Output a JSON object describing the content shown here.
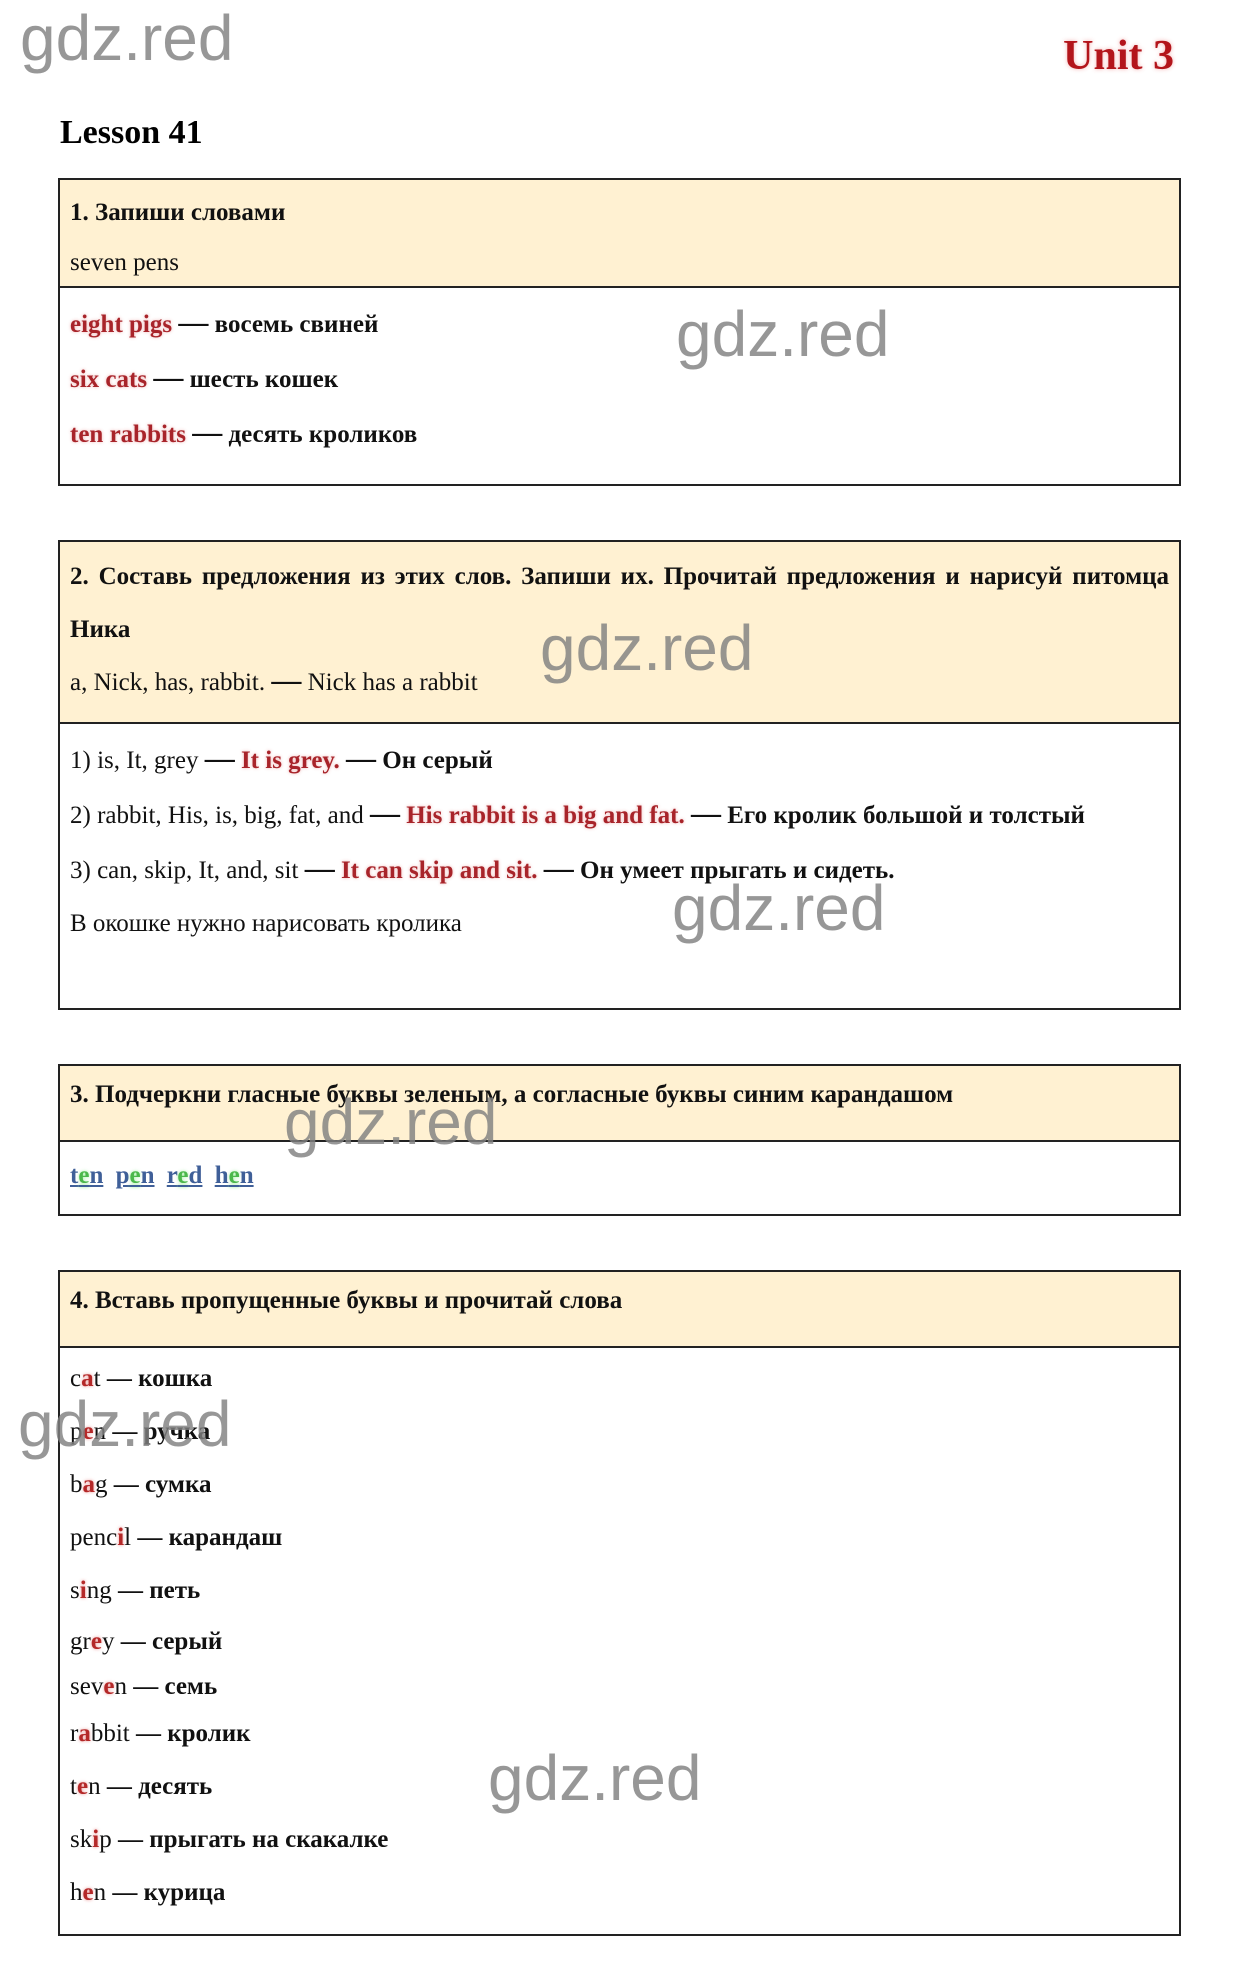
{
  "watermark": "gdz.red",
  "header": {
    "unit": "Unit 3",
    "lesson": "Lesson 41"
  },
  "task1": {
    "title": "1. Запиши словами",
    "example": "seven pens",
    "answers": [
      {
        "en": "eight pigs",
        "dash": "—",
        "ru": "восемь свиней"
      },
      {
        "en": "six cats",
        "dash": "—",
        "ru": "шесть кошек"
      },
      {
        "en": "ten rabbits",
        "dash": "—",
        "ru": "десять кроликов"
      }
    ]
  },
  "task2": {
    "title": "2. Составь предложения из этих слов. Запиши их. Прочитай предложения и нарисуй питомца Ника",
    "example_words": "a, Nick, has, rabbit.",
    "example_dash": "—",
    "example_sentence": "Nick has a rabbit",
    "answers": [
      {
        "words": "1) is, It, grey",
        "sentence": "It is grey.",
        "translation": "Он серый"
      },
      {
        "words": "2) rabbit, His, is, big, fat, and",
        "sentence": "His rabbit is a big and fat.",
        "translation": "Его кролик большой и толстый"
      },
      {
        "words": "3) can, skip, It, and, sit",
        "sentence": "It can skip and sit.",
        "translation": "Он умеет прыгать и сидеть."
      }
    ],
    "dash": "—",
    "note": "В окошке нужно нарисовать кролика"
  },
  "task3": {
    "title": "3. Подчеркни гласные буквы зеленым, а согласные буквы синим карандашом",
    "words": [
      {
        "pre": "t",
        "vowel": "e",
        "post": "n"
      },
      {
        "pre": "p",
        "vowel": "e",
        "post": "n"
      },
      {
        "pre": "r",
        "vowel": "e",
        "post": "d"
      },
      {
        "pre": "h",
        "vowel": "e",
        "post": "n"
      }
    ],
    "colors": {
      "vowel": "#4cb84c",
      "consonant": "#3f5f98"
    }
  },
  "task4": {
    "title": "4. Вставь пропущенные буквы и прочитай слова",
    "dash": "—",
    "items": [
      {
        "pre": "c",
        "missing": "a",
        "post": "t",
        "ru": "кошка"
      },
      {
        "pre": "p",
        "missing": "e",
        "post": "n",
        "ru": "ручка"
      },
      {
        "pre": "b",
        "missing": "a",
        "post": "g",
        "ru": "сумка"
      },
      {
        "pre": "penc",
        "missing": "i",
        "post": "l",
        "ru": "карандаш"
      },
      {
        "pre": "s",
        "missing": "i",
        "post": "ng",
        "ru": "петь"
      },
      {
        "pre": "gr",
        "missing": "e",
        "post": "y",
        "ru": "серый"
      },
      {
        "pre": "sev",
        "missing": "e",
        "post": "n",
        "ru": "семь"
      },
      {
        "pre": "r",
        "missing": "a",
        "post": "bbit",
        "ru": "кролик"
      },
      {
        "pre": "t",
        "missing": "e",
        "post": "n",
        "ru": "десять"
      },
      {
        "pre": "sk",
        "missing": "i",
        "post": "p",
        "ru": "прыгать на скакалке"
      },
      {
        "pre": "h",
        "missing": "e",
        "post": "n",
        "ru": "курица"
      }
    ]
  },
  "colors": {
    "accent_red": "#a8242a",
    "header_bg": "#fff1d2",
    "border": "#222222"
  }
}
